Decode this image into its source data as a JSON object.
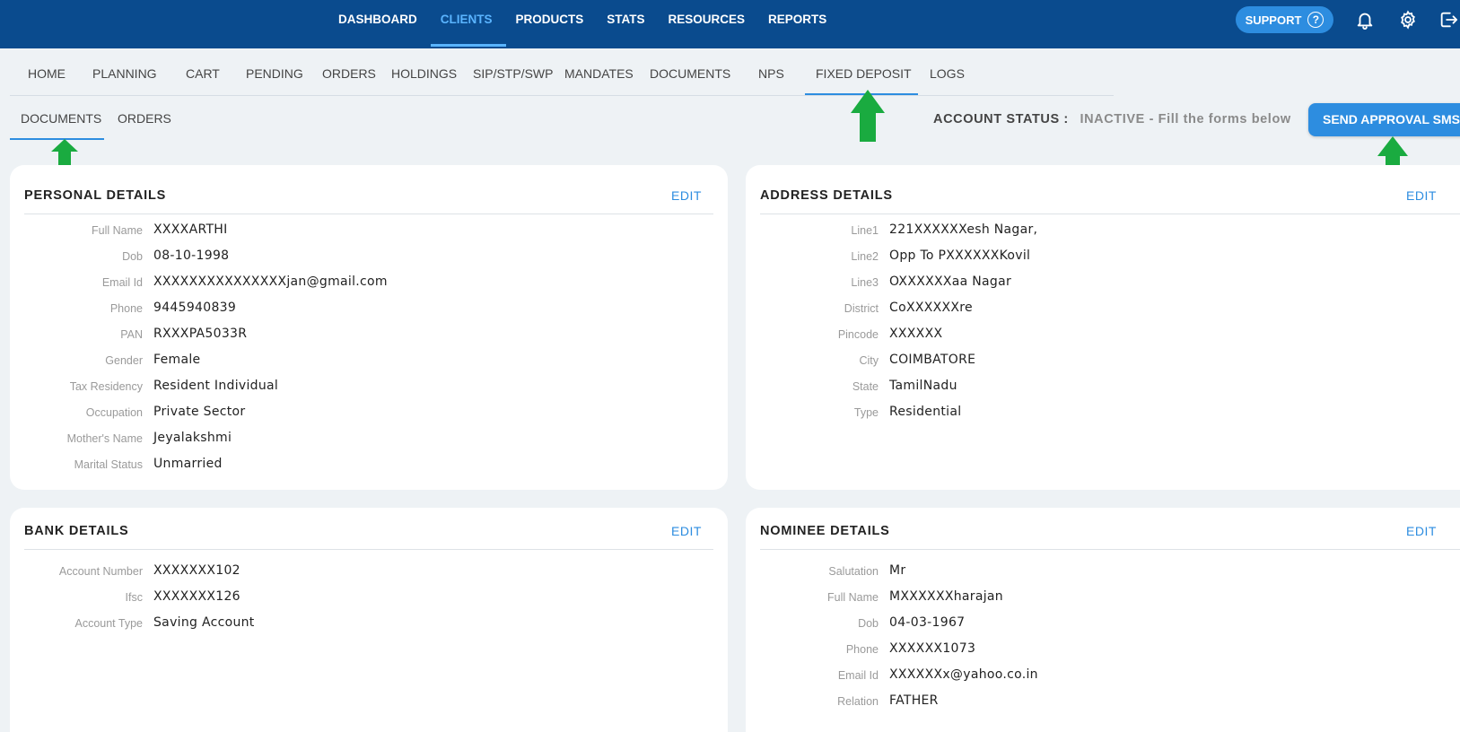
{
  "topnav": {
    "items": [
      "DASHBOARD",
      "CLIENTS",
      "PRODUCTS",
      "STATS",
      "RESOURCES",
      "REPORTS"
    ],
    "active": "CLIENTS",
    "support_label": "SUPPORT",
    "support_icon": "question-circle-icon",
    "icons": [
      "bell-icon",
      "gear-icon",
      "logout-icon"
    ]
  },
  "subnav": {
    "items": [
      "HOME",
      "PLANNING",
      "CART",
      "PENDING",
      "ORDERS",
      "HOLDINGS",
      "SIP/STP/SWP",
      "MANDATES",
      "DOCUMENTS",
      "NPS",
      "FIXED DEPOSIT",
      "LOGS"
    ],
    "active": "FIXED DEPOSIT"
  },
  "tabs": {
    "items": [
      "DOCUMENTS",
      "ORDERS"
    ],
    "active": "DOCUMENTS"
  },
  "account": {
    "status_label": "ACCOUNT STATUS :",
    "status_value": "INACTIVE - Fill the forms below",
    "send_button": "SEND APPROVAL SMS"
  },
  "personal": {
    "title": "PERSONAL DETAILS",
    "edit": "EDIT",
    "rows": [
      {
        "label": "Full Name",
        "value": "XXXXARTHI"
      },
      {
        "label": "Dob",
        "value": "08-10-1998"
      },
      {
        "label": "Email Id",
        "value": "XXXXXXXXXXXXXXXjan@gmail.com"
      },
      {
        "label": "Phone",
        "value": "9445940839"
      },
      {
        "label": "PAN",
        "value": "RXXXPA5033R"
      },
      {
        "label": "Gender",
        "value": "Female"
      },
      {
        "label": "Tax Residency",
        "value": "Resident Individual"
      },
      {
        "label": "Occupation",
        "value": "Private Sector"
      },
      {
        "label": "Mother's Name",
        "value": "Jeyalakshmi"
      },
      {
        "label": "Marital Status",
        "value": "Unmarried"
      }
    ]
  },
  "address": {
    "title": "ADDRESS DETAILS",
    "edit": "EDIT",
    "rows": [
      {
        "label": "Line1",
        "value": "221XXXXXXesh Nagar,"
      },
      {
        "label": "Line2",
        "value": "Opp To PXXXXXXKovil"
      },
      {
        "label": "Line3",
        "value": "OXXXXXXaa Nagar"
      },
      {
        "label": "District",
        "value": "CoXXXXXXre"
      },
      {
        "label": "Pincode",
        "value": "XXXXXX"
      },
      {
        "label": "City",
        "value": "COIMBATORE"
      },
      {
        "label": "State",
        "value": "TamilNadu"
      },
      {
        "label": "Type",
        "value": "Residential"
      }
    ]
  },
  "bank": {
    "title": "BANK DETAILS",
    "edit": "EDIT",
    "rows": [
      {
        "label": "Account Number",
        "value": "XXXXXXX102"
      },
      {
        "label": "Ifsc",
        "value": "XXXXXXX126"
      },
      {
        "label": "Account Type",
        "value": "Saving Account"
      }
    ]
  },
  "nominee": {
    "title": "NOMINEE DETAILS",
    "edit": "EDIT",
    "rows": [
      {
        "label": "Salutation",
        "value": "Mr"
      },
      {
        "label": "Full Name",
        "value": "MXXXXXXharajan"
      },
      {
        "label": "Dob",
        "value": "04-03-1967"
      },
      {
        "label": "Phone",
        "value": "XXXXXX1073"
      },
      {
        "label": "Email Id",
        "value": "XXXXXXx@yahoo.co.in"
      },
      {
        "label": "Relation",
        "value": "FATHER"
      }
    ]
  },
  "colors": {
    "navbar": "#0a4b8e",
    "accent": "#2d8de0",
    "arrow": "#1aab40"
  }
}
